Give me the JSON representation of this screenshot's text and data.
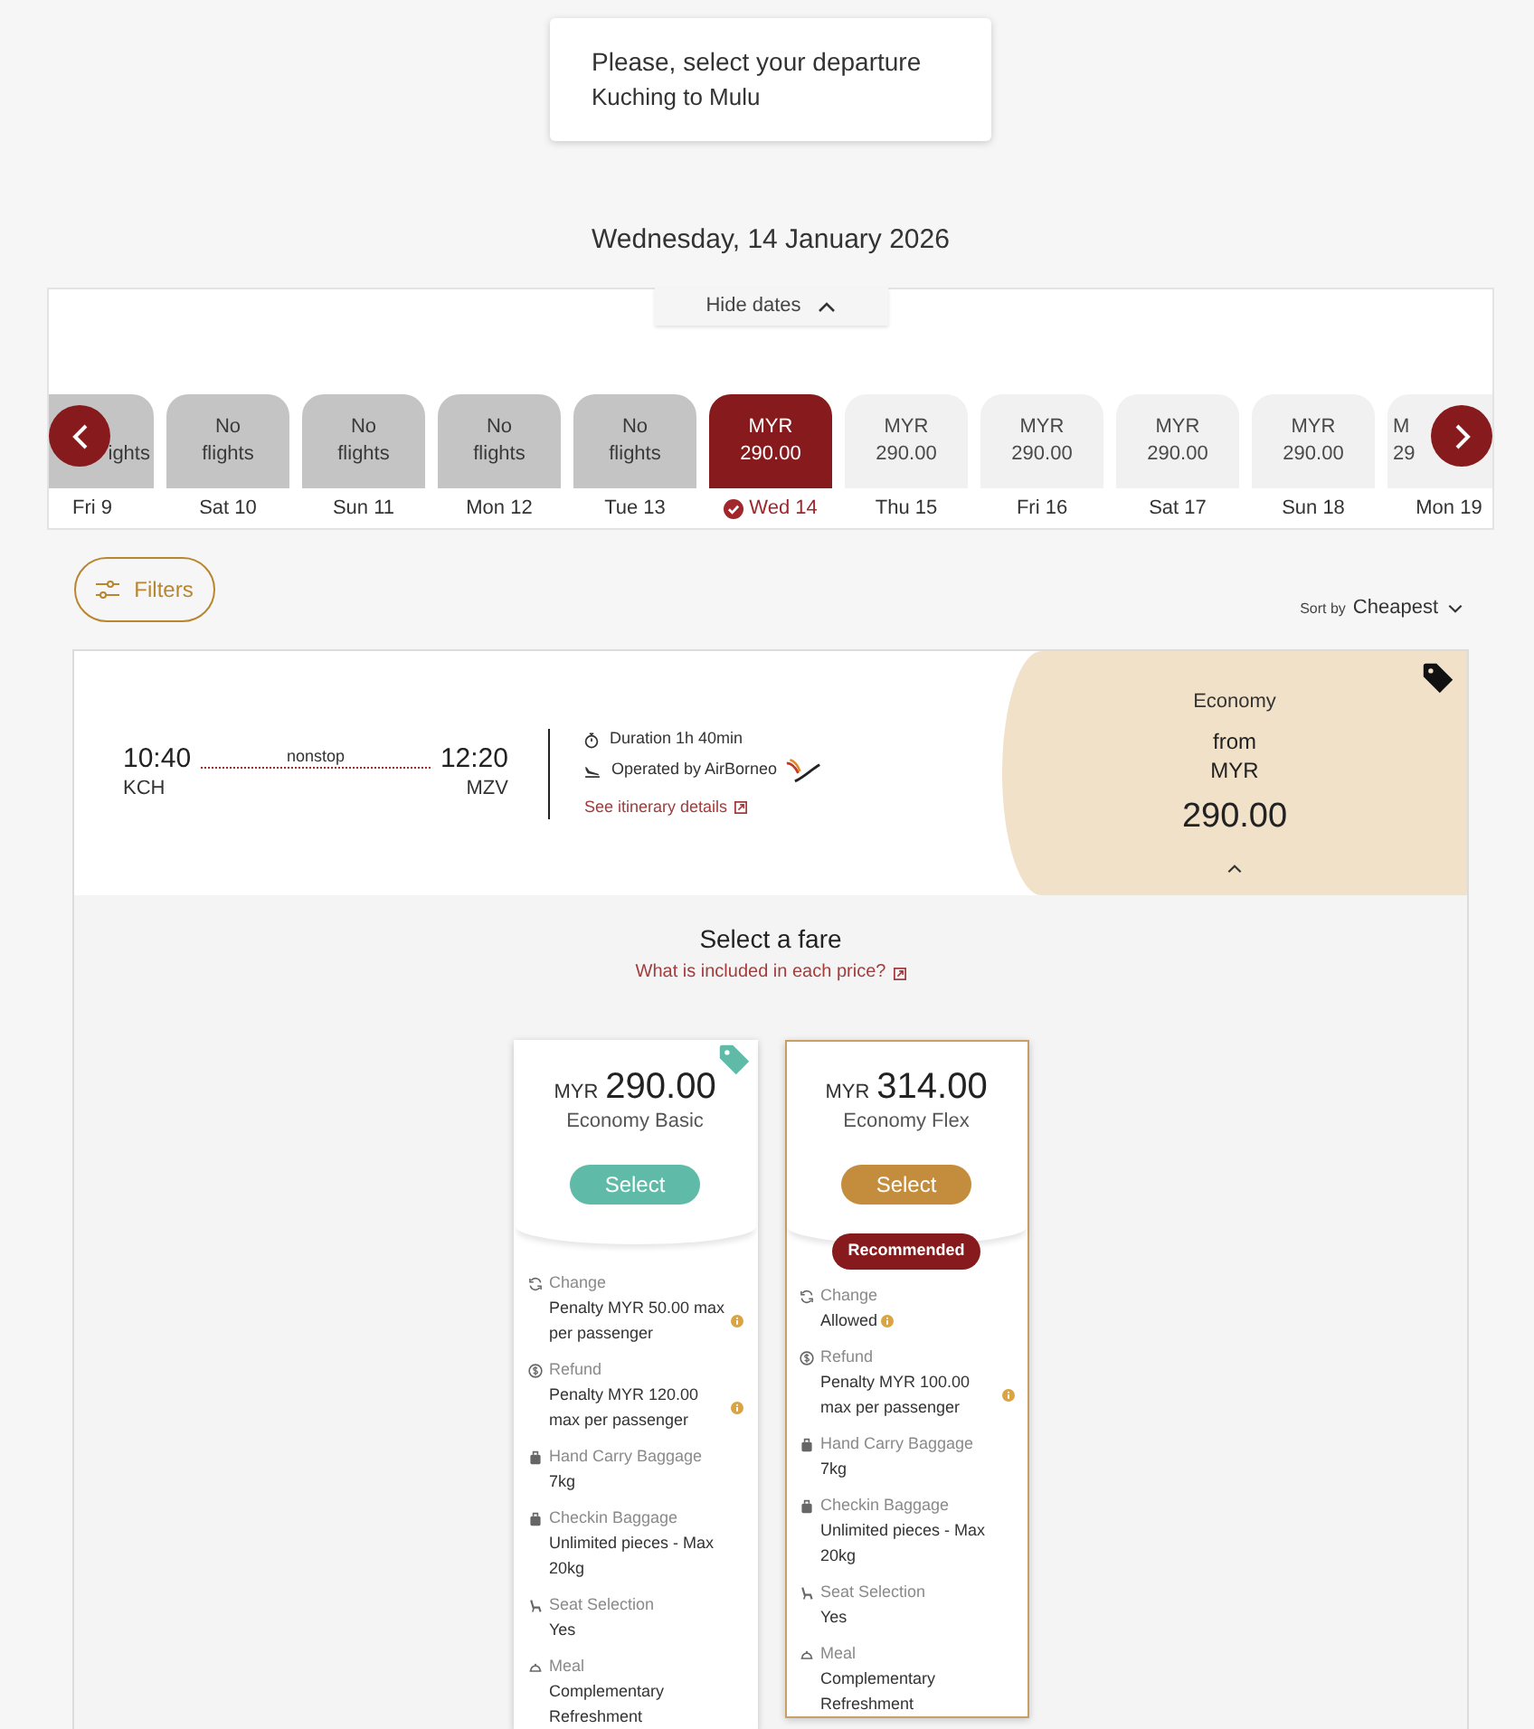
{
  "header": {
    "title": "Please, select your departure",
    "route": "Kuching to Mulu"
  },
  "date_heading": "Wednesday, 14 January 2026",
  "date_strip": {
    "toggle": "Hide dates",
    "expanded": true,
    "dates": [
      {
        "day": "Fri 9",
        "fare": [
          "ights"
        ],
        "kind": "unavailable",
        "clipped": true,
        "selected": false
      },
      {
        "day": "Sat 10",
        "fare": [
          "No",
          "flights"
        ],
        "kind": "unavailable",
        "clipped": false,
        "selected": false
      },
      {
        "day": "Sun 11",
        "fare": [
          "No",
          "flights"
        ],
        "kind": "unavailable",
        "clipped": false,
        "selected": false
      },
      {
        "day": "Mon 12",
        "fare": [
          "No",
          "flights"
        ],
        "kind": "unavailable",
        "clipped": false,
        "selected": false
      },
      {
        "day": "Tue 13",
        "fare": [
          "No",
          "flights"
        ],
        "kind": "unavailable",
        "clipped": false,
        "selected": false
      },
      {
        "day": "Wed 14",
        "fare": [
          "MYR",
          "290.00"
        ],
        "kind": "available",
        "clipped": false,
        "selected": true
      },
      {
        "day": "Thu 15",
        "fare": [
          "MYR",
          "290.00"
        ],
        "kind": "available",
        "clipped": false,
        "selected": false
      },
      {
        "day": "Fri 16",
        "fare": [
          "MYR",
          "290.00"
        ],
        "kind": "available",
        "clipped": false,
        "selected": false
      },
      {
        "day": "Sat 17",
        "fare": [
          "MYR",
          "290.00"
        ],
        "kind": "available",
        "clipped": false,
        "selected": false
      },
      {
        "day": "Sun 18",
        "fare": [
          "MYR",
          "290.00"
        ],
        "kind": "available",
        "clipped": false,
        "selected": false
      },
      {
        "day": "Mon 19",
        "fare": [
          "M",
          "29"
        ],
        "kind": "available",
        "clipped": true,
        "selected": false
      }
    ]
  },
  "filters": {
    "label": "Filters"
  },
  "sort": {
    "label": "Sort by",
    "value": "Cheapest"
  },
  "flight": {
    "departure_time": "10:40",
    "departure_airport": "KCH",
    "stops": "nonstop",
    "arrival_time": "12:20",
    "arrival_airport": "MZV",
    "duration": "Duration 1h 40min",
    "operator": "Operated by AirBorneo",
    "details_link": "See itinerary details",
    "cabin": {
      "name": "Economy",
      "from": "from",
      "currency": "MYR",
      "price": "290.00",
      "expanded": true,
      "tag": true
    }
  },
  "fare_selection": {
    "title": "Select a fare",
    "link": "What is included in each price?",
    "fares": [
      {
        "currency": "MYR",
        "price": "290.00",
        "name": "Economy Basic",
        "button": "Select",
        "color": "#5fbba8",
        "tag": true,
        "highlighted": false,
        "features": [
          {
            "kind": "change",
            "label": "Change",
            "value": "Penalty MYR 50.00 max per passenger",
            "info": true
          },
          {
            "kind": "refund",
            "label": "Refund",
            "value": "Penalty MYR 120.00 max per passenger",
            "info": true
          },
          {
            "kind": "hand_baggage",
            "label": "Hand Carry Baggage",
            "value": "7kg",
            "info": false
          },
          {
            "kind": "checkin_baggage",
            "label": "Checkin Baggage",
            "value": "Unlimited pieces - Max 20kg",
            "info": false
          },
          {
            "kind": "seat",
            "label": "Seat Selection",
            "value": "Yes",
            "info": false
          },
          {
            "kind": "meal",
            "label": "Meal",
            "value": "Complementary Refreshment",
            "info": false
          }
        ]
      },
      {
        "currency": "MYR",
        "price": "314.00",
        "name": "Economy Flex",
        "button": "Select",
        "color": "#c38d3d",
        "tag": false,
        "highlighted": true,
        "badge": "Recommended",
        "features": [
          {
            "kind": "change",
            "label": "Change",
            "value": "Allowed",
            "info": true
          },
          {
            "kind": "refund",
            "label": "Refund",
            "value": "Penalty MYR 100.00 max per passenger",
            "info": true
          },
          {
            "kind": "hand_baggage",
            "label": "Hand Carry Baggage",
            "value": "7kg",
            "info": false
          },
          {
            "kind": "checkin_baggage",
            "label": "Checkin Baggage",
            "value": "Unlimited pieces - Max 20kg",
            "info": false
          },
          {
            "kind": "seat",
            "label": "Seat Selection",
            "value": "Yes",
            "info": false
          },
          {
            "kind": "meal",
            "label": "Meal",
            "value": "Complementary Refreshment",
            "info": false
          }
        ]
      }
    ]
  }
}
